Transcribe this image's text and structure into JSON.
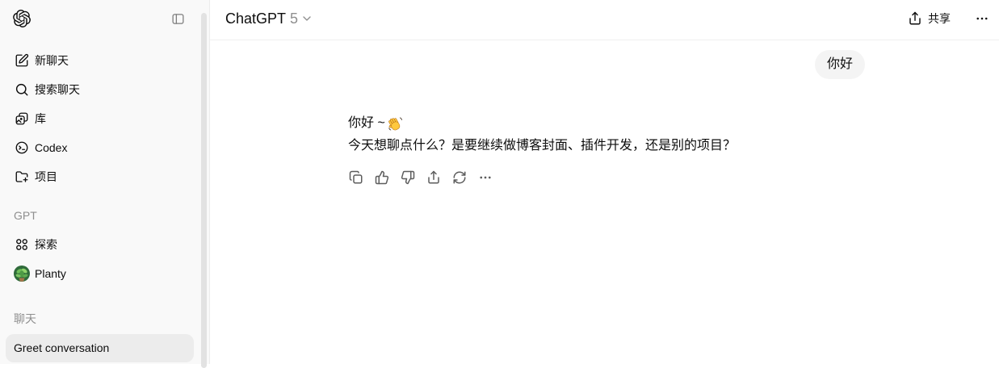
{
  "sidebar": {
    "logo_icon": "openai-logo",
    "toggle_icon": "panel-left-icon",
    "nav": [
      {
        "label": "新聊天",
        "icon": "new-chat-icon"
      },
      {
        "label": "搜索聊天",
        "icon": "search-icon"
      },
      {
        "label": "库",
        "icon": "library-icon"
      },
      {
        "label": "Codex",
        "icon": "codex-icon"
      },
      {
        "label": "项目",
        "icon": "folder-plus-icon"
      }
    ],
    "gpt_section": {
      "title": "GPT",
      "items": [
        {
          "label": "探索",
          "icon": "explore-grid-icon"
        },
        {
          "label": "Planty",
          "icon": "planty-avatar"
        }
      ]
    },
    "chats_section": {
      "title": "聊天",
      "items": [
        {
          "label": "Greet conversation",
          "active": true
        }
      ]
    }
  },
  "header": {
    "model_name": "ChatGPT",
    "model_version": "5",
    "model_menu_icon": "chevron-down-icon",
    "share_label": "共享",
    "share_icon": "share-icon",
    "more_icon": "ellipsis-icon"
  },
  "conversation": {
    "user_message": "你好",
    "assistant": {
      "greeting": "你好 ~",
      "greeting_emoji": "👋",
      "body": "今天想聊点什么？是要继续做博客封面、插件开发，还是别的项目？"
    },
    "actions": [
      "copy-icon",
      "thumbs-up-icon",
      "thumbs-down-icon",
      "share-icon",
      "regenerate-icon",
      "more-icon"
    ]
  },
  "colors": {
    "text": "#0d0d0d",
    "muted_text": "#8f8f8f",
    "sidebar_bg": "#f9f9f9",
    "active_chat_bg": "#ececec",
    "user_bubble_bg": "#f4f4f4",
    "icon_gray": "#5d5d5d"
  }
}
